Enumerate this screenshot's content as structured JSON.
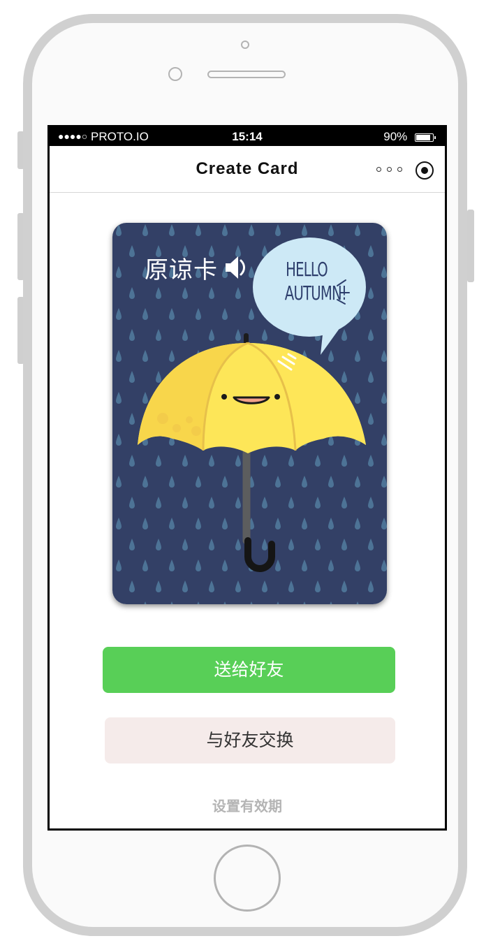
{
  "status_bar": {
    "signal": "●●●●○",
    "carrier": "PROTO.IO",
    "time": "15:14",
    "battery_percent": "90%",
    "battery_level": 0.9
  },
  "nav": {
    "title": "Create Card",
    "more_icon": "more-dots-icon",
    "record_icon": "record-target-icon"
  },
  "card": {
    "label": "原谅卡",
    "speaker_icon": "speaker-icon",
    "bubble_text_line1": "HELLO",
    "bubble_text_line2": "AUTUMN!",
    "colors": {
      "background": "#334066",
      "raindrop": "#4d7396",
      "umbrella": "#fde658",
      "bubble": "#cde9f6"
    }
  },
  "actions": {
    "send_label": "送给好友",
    "exchange_label": "与好友交换",
    "expiry_label": "设置有效期",
    "send_color": "#58cf57",
    "exchange_color": "#f5ebea"
  }
}
